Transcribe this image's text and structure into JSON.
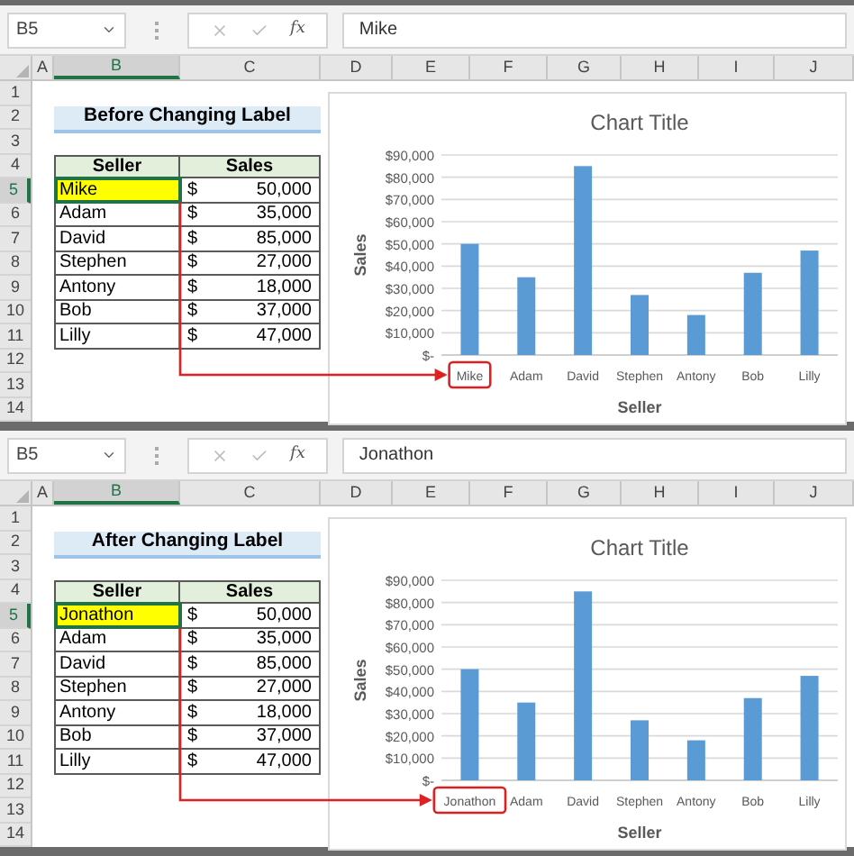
{
  "panels": [
    {
      "name_box": "B5",
      "fx": "fx",
      "formula_value": "Mike",
      "columns": [
        {
          "label": "A",
          "selected": false
        },
        {
          "label": "B",
          "selected": true
        },
        {
          "label": "C",
          "selected": false
        },
        {
          "label": "D",
          "selected": false
        },
        {
          "label": "E",
          "selected": false
        },
        {
          "label": "F",
          "selected": false
        },
        {
          "label": "G",
          "selected": false
        },
        {
          "label": "H",
          "selected": false
        },
        {
          "label": "I",
          "selected": false
        },
        {
          "label": "J",
          "selected": false
        }
      ],
      "row_numbers": [
        {
          "label": "1",
          "selected": false
        },
        {
          "label": "2",
          "selected": false
        },
        {
          "label": "3",
          "selected": false
        },
        {
          "label": "4",
          "selected": false
        },
        {
          "label": "5",
          "selected": true
        },
        {
          "label": "6",
          "selected": false
        },
        {
          "label": "7",
          "selected": false
        },
        {
          "label": "8",
          "selected": false
        },
        {
          "label": "9",
          "selected": false
        },
        {
          "label": "10",
          "selected": false
        },
        {
          "label": "11",
          "selected": false
        },
        {
          "label": "12",
          "selected": false
        },
        {
          "label": "13",
          "selected": false
        },
        {
          "label": "14",
          "selected": false
        }
      ],
      "title": "Before Changing Label",
      "callout": {
        "kind": "arrow_to_first_label"
      },
      "table": {
        "columns": [
          "Seller",
          "Sales"
        ],
        "rows": [
          {
            "seller": "Mike",
            "currency": "$",
            "sales": "50,000",
            "selected": true
          },
          {
            "seller": "Adam",
            "currency": "$",
            "sales": "35,000",
            "selected": false
          },
          {
            "seller": "David",
            "currency": "$",
            "sales": "85,000",
            "selected": false
          },
          {
            "seller": "Stephen",
            "currency": "$",
            "sales": "27,000",
            "selected": false
          },
          {
            "seller": "Antony",
            "currency": "$",
            "sales": "18,000",
            "selected": false
          },
          {
            "seller": "Bob",
            "currency": "$",
            "sales": "37,000",
            "selected": false
          },
          {
            "seller": "Lilly",
            "currency": "$",
            "sales": "47,000",
            "selected": false
          }
        ]
      },
      "chart_data": {
        "type": "bar",
        "title": "Chart Title",
        "xlabel": "Seller",
        "ylabel": "Sales",
        "categories": [
          "Mike",
          "Adam",
          "David",
          "Stephen",
          "Antony",
          "Bob",
          "Lilly"
        ],
        "series": [
          {
            "color": "#5b9bd5",
            "values": [
              50000,
              35000,
              85000,
              27000,
              18000,
              37000,
              47000
            ]
          }
        ],
        "ylim": [
          0,
          90000
        ],
        "grid": true,
        "yticks": [
          {
            "value": 0,
            "label": "$-"
          },
          {
            "value": 10000,
            "label": "$10,000"
          },
          {
            "value": 20000,
            "label": "$20,000"
          },
          {
            "value": 30000,
            "label": "$30,000"
          },
          {
            "value": 40000,
            "label": "$40,000"
          },
          {
            "value": 50000,
            "label": "$50,000"
          },
          {
            "value": 60000,
            "label": "$60,000"
          },
          {
            "value": 70000,
            "label": "$70,000"
          },
          {
            "value": 80000,
            "label": "$80,000"
          },
          {
            "value": 90000,
            "label": "$90,000"
          }
        ]
      }
    },
    {
      "name_box": "B5",
      "fx": "fx",
      "formula_value": "Jonathon",
      "columns": [
        {
          "label": "A",
          "selected": false
        },
        {
          "label": "B",
          "selected": true
        },
        {
          "label": "C",
          "selected": false
        },
        {
          "label": "D",
          "selected": false
        },
        {
          "label": "E",
          "selected": false
        },
        {
          "label": "F",
          "selected": false
        },
        {
          "label": "G",
          "selected": false
        },
        {
          "label": "H",
          "selected": false
        },
        {
          "label": "I",
          "selected": false
        },
        {
          "label": "J",
          "selected": false
        }
      ],
      "row_numbers": [
        {
          "label": "1",
          "selected": false
        },
        {
          "label": "2",
          "selected": false
        },
        {
          "label": "3",
          "selected": false
        },
        {
          "label": "4",
          "selected": false
        },
        {
          "label": "5",
          "selected": true
        },
        {
          "label": "6",
          "selected": false
        },
        {
          "label": "7",
          "selected": false
        },
        {
          "label": "8",
          "selected": false
        },
        {
          "label": "9",
          "selected": false
        },
        {
          "label": "10",
          "selected": false
        },
        {
          "label": "11",
          "selected": false
        },
        {
          "label": "12",
          "selected": false
        },
        {
          "label": "13",
          "selected": false
        },
        {
          "label": "14",
          "selected": false
        }
      ],
      "title": "After Changing Label",
      "callout": {
        "kind": "arrow_to_first_label"
      },
      "table": {
        "columns": [
          "Seller",
          "Sales"
        ],
        "rows": [
          {
            "seller": "Jonathon",
            "currency": "$",
            "sales": "50,000",
            "selected": true
          },
          {
            "seller": "Adam",
            "currency": "$",
            "sales": "35,000",
            "selected": false
          },
          {
            "seller": "David",
            "currency": "$",
            "sales": "85,000",
            "selected": false
          },
          {
            "seller": "Stephen",
            "currency": "$",
            "sales": "27,000",
            "selected": false
          },
          {
            "seller": "Antony",
            "currency": "$",
            "sales": "18,000",
            "selected": false
          },
          {
            "seller": "Bob",
            "currency": "$",
            "sales": "37,000",
            "selected": false
          },
          {
            "seller": "Lilly",
            "currency": "$",
            "sales": "47,000",
            "selected": false
          }
        ]
      },
      "chart_data": {
        "type": "bar",
        "title": "Chart Title",
        "xlabel": "Seller",
        "ylabel": "Sales",
        "categories": [
          "Jonathon",
          "Adam",
          "David",
          "Stephen",
          "Antony",
          "Bob",
          "Lilly"
        ],
        "series": [
          {
            "color": "#5b9bd5",
            "values": [
              50000,
              35000,
              85000,
              27000,
              18000,
              37000,
              47000
            ]
          }
        ],
        "ylim": [
          0,
          90000
        ],
        "grid": true,
        "yticks": [
          {
            "value": 0,
            "label": "$-"
          },
          {
            "value": 10000,
            "label": "$10,000"
          },
          {
            "value": 20000,
            "label": "$20,000"
          },
          {
            "value": 30000,
            "label": "$30,000"
          },
          {
            "value": 40000,
            "label": "$40,000"
          },
          {
            "value": 50000,
            "label": "$50,000"
          },
          {
            "value": 60000,
            "label": "$60,000"
          },
          {
            "value": 70000,
            "label": "$70,000"
          },
          {
            "value": 80000,
            "label": "$80,000"
          },
          {
            "value": 90000,
            "label": "$90,000"
          }
        ]
      }
    }
  ]
}
